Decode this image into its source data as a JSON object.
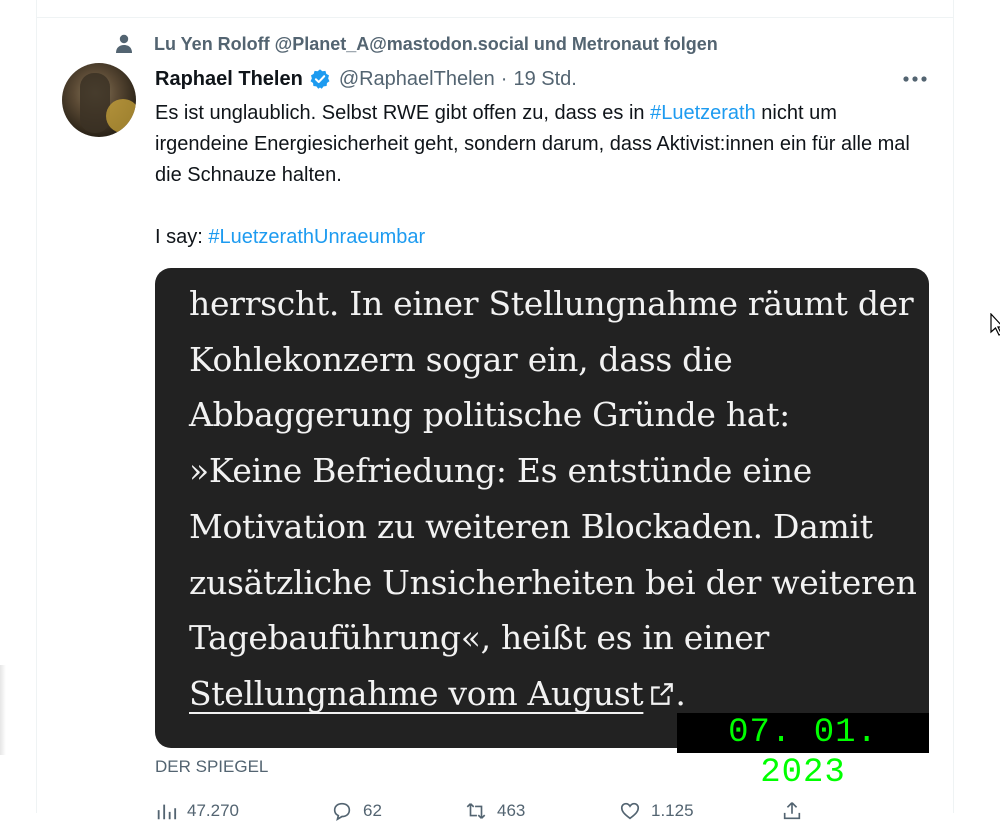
{
  "social_context": {
    "text": "Lu Yen Roloff @Planet_A@mastodon.social und Metronaut folgen",
    "icon": "person-icon"
  },
  "tweet": {
    "author_name": "Raphael Thelen",
    "verified": true,
    "handle": "@RaphaelThelen",
    "separator": "·",
    "time": "19 Std.",
    "more_label": "•••",
    "text_1": "Es ist unglaublich. Selbst RWE gibt offen zu, dass es in ",
    "hashtag_1": "#Luetzerath",
    "text_2": " nicht um irgendeine Energiesicherheit geht, sondern darum, dass Aktivist:innen ein für alle mal die Schnauze halten.",
    "text_3": "I say: ",
    "hashtag_2": "#LuetzerathUnraeumbar"
  },
  "media": {
    "lines": [
      "herrscht. In einer Stellungnahme räumt der",
      "Kohlekonzern sogar ein, dass die",
      "Abbaggerung politische Gründe hat:",
      "»Keine Befriedung: Es entstünde eine",
      "Motivation zu weiteren Blockaden. Damit",
      "zusätzliche Unsicherheiten bei der weiteren",
      "Tagebauführung«, heißt es in einer"
    ],
    "link_text": "Stellungnahme vom August",
    "link_after": ".",
    "date_stamp": "07. 01. 2023",
    "source": "DER SPIEGEL"
  },
  "actions": {
    "views": "47.270",
    "replies": "62",
    "retweets": "463",
    "likes": "1.125"
  },
  "colors": {
    "accent": "#1d9bf0",
    "secondary_text": "#536471",
    "media_bg": "#222222",
    "stamp_text": "#00ff00"
  }
}
